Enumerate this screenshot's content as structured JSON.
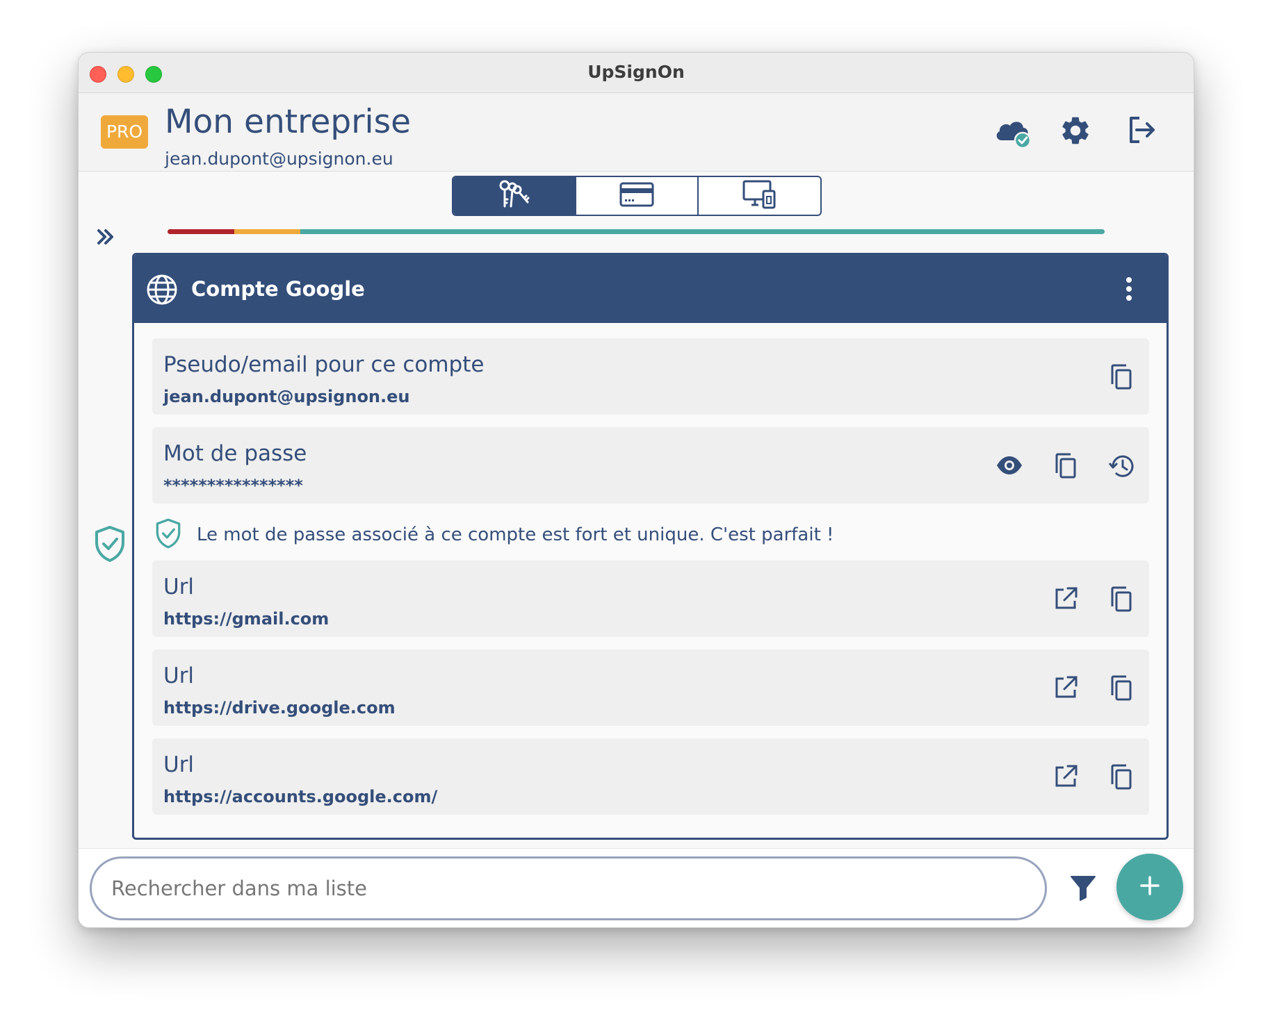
{
  "window": {
    "title": "UpSignOn"
  },
  "header": {
    "badge": "PRO",
    "org_name": "Mon entreprise",
    "user_email": "jean.dupont@upsignon.eu",
    "icons": [
      "cloud-sync-icon",
      "gear-icon",
      "logout-icon"
    ]
  },
  "tabs": [
    {
      "icon": "keys-icon",
      "active": true
    },
    {
      "icon": "credit-card-icon",
      "active": false
    },
    {
      "icon": "devices-icon",
      "active": false
    }
  ],
  "strength_bar": {
    "segments": [
      {
        "color": "#b0232a",
        "fraction": 0.071
      },
      {
        "color": "#efa93b",
        "fraction": 0.071
      },
      {
        "color": "#4aa8a3",
        "fraction": 0.858
      }
    ]
  },
  "card": {
    "title": "Compte Google",
    "fields": [
      {
        "label": "Pseudo/email pour ce compte",
        "value": "jean.dupont@upsignon.eu",
        "actions": [
          "copy-icon"
        ]
      },
      {
        "label": "Mot de passe",
        "value": "****************",
        "actions": [
          "eye-icon",
          "copy-icon",
          "history-icon"
        ]
      },
      {
        "label": "Url",
        "value": "https://gmail.com",
        "actions": [
          "open-external-icon",
          "copy-icon"
        ]
      },
      {
        "label": "Url",
        "value": "https://drive.google.com",
        "actions": [
          "open-external-icon",
          "copy-icon"
        ]
      },
      {
        "label": "Url",
        "value": "https://accounts.google.com/",
        "actions": [
          "open-external-icon",
          "copy-icon"
        ]
      }
    ],
    "strength_message": "Le mot de passe associé à ce compte est fort et unique. C'est parfait !"
  },
  "search": {
    "placeholder": "Rechercher dans ma liste",
    "value": ""
  },
  "colors": {
    "primary": "#344e7a",
    "accent": "#4aa8a3",
    "badge": "#efa93b",
    "danger": "#b0232a"
  }
}
